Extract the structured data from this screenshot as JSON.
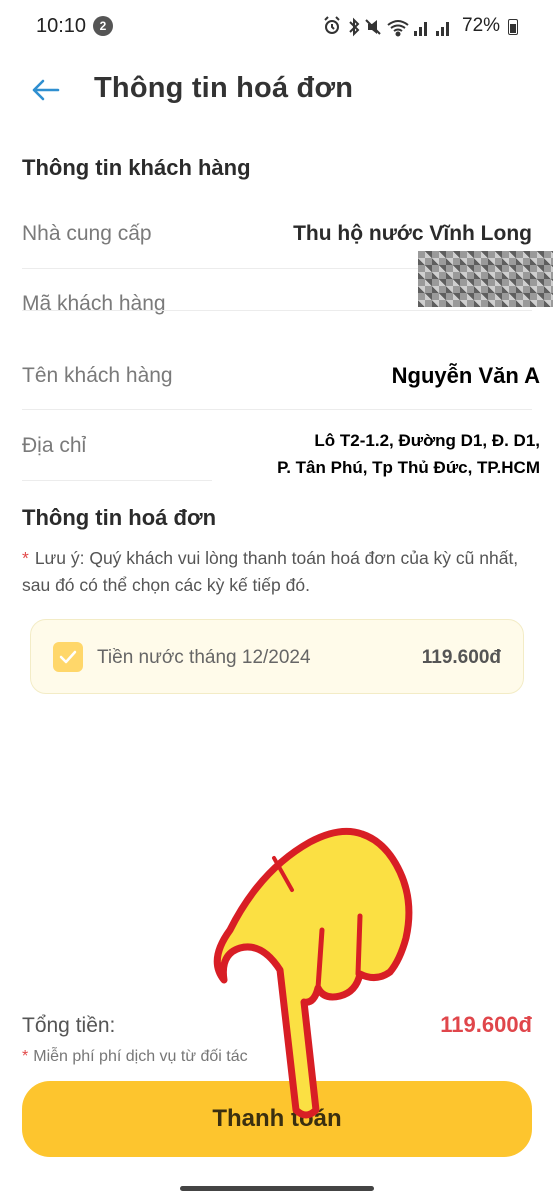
{
  "status_bar": {
    "time": "10:10",
    "notification_count": "2",
    "battery": "72%"
  },
  "header": {
    "title": "Thông tin hoá đơn",
    "back_icon": "arrow-left-icon"
  },
  "customer_section": {
    "title": "Thông tin khách hàng",
    "provider_label": "Nhà cung cấp",
    "provider_value": "Thu hộ nước Vĩnh Long",
    "customer_id_label": "Mã khách hàng",
    "customer_name_label": "Tên khách hàng",
    "customer_name_value": "Nguyễn Văn A",
    "address_label": "Địa chỉ",
    "address_line1": "Lô T2-1.2, Đường D1, Đ. D1,",
    "address_line2": "P. Tân Phú, Tp Thủ Đức, TP.HCM"
  },
  "bill_section": {
    "title": "Thông tin hoá đơn",
    "note_star": "*",
    "note_text": "Lưu ý: Quý khách vui lòng thanh toán hoá đơn của kỳ cũ nhất, sau đó có thể chọn các kỳ kế tiếp đó.",
    "items": [
      {
        "label": "Tiền nước tháng 12/2024",
        "amount": "119.600đ",
        "checked": true
      }
    ]
  },
  "footer": {
    "total_label": "Tổng tiền:",
    "total_value": "119.600đ",
    "fee_star": "*",
    "fee_note": "Miễn phí phí dịch vụ từ đối tác",
    "pay_button": "Thanh toán"
  },
  "colors": {
    "accent": "#fdc52e",
    "total_red": "#e0464b",
    "back_arrow": "#2f8fd0",
    "hand_fill": "#fbe043",
    "hand_outline": "#d81e25"
  }
}
